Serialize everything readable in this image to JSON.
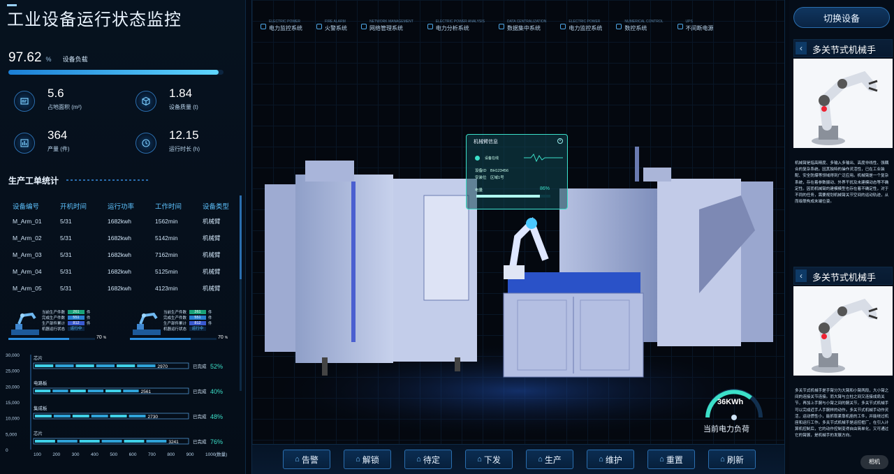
{
  "page": {
    "title": "工业设备运行状态监控"
  },
  "load": {
    "value": "97.62",
    "unit": "%",
    "label": "设备负载",
    "percent": 97.62
  },
  "stats": [
    {
      "value": "5.6",
      "label": "占地面积 (m²)",
      "icon": "area-icon"
    },
    {
      "value": "1.84",
      "label": "设备质量 (t)",
      "icon": "cube-icon"
    },
    {
      "value": "364",
      "label": "产量 (件)",
      "icon": "chart-icon"
    },
    {
      "value": "12.15",
      "label": "运行时长 (h)",
      "icon": "clock-icon"
    }
  ],
  "orders": {
    "title": "生产工单统计",
    "headers": [
      "设备编号",
      "开机时间",
      "运行功率",
      "工作时间",
      "设备类型"
    ],
    "rows": [
      [
        "M_Arm_01",
        "5/31",
        "1682kwh",
        "1562min",
        "机械臂"
      ],
      [
        "M_Arm_02",
        "5/31",
        "1682kwh",
        "5142min",
        "机械臂"
      ],
      [
        "M_Arm_03",
        "5/31",
        "1682kwh",
        "7162min",
        "机械臂"
      ],
      [
        "M_Arm_04",
        "5/31",
        "1682kwh",
        "5125min",
        "机械臂"
      ],
      [
        "M_Arm_05",
        "5/31",
        "1682kwh",
        "4123min",
        "机械臂"
      ]
    ]
  },
  "mini_cards": [
    {
      "rows": [
        [
          "当前生产件数",
          "261",
          "件"
        ],
        [
          "完成生产件数",
          "551",
          "件"
        ],
        [
          "生产部件累计",
          "812",
          "件"
        ],
        [
          "机器运行状态",
          "运行中",
          ""
        ]
      ],
      "pct": "70",
      "pct_unit": "%",
      "fraction": 0.7
    },
    {
      "rows": [
        [
          "当前生产件数",
          "261",
          "件"
        ],
        [
          "完成生产件数",
          "551",
          "件"
        ],
        [
          "生产部件累计",
          "812",
          "件"
        ],
        [
          "机器运行状态",
          "运行中",
          ""
        ]
      ],
      "pct": "70",
      "pct_unit": "%",
      "fraction": 0.7
    }
  ],
  "chart_data": {
    "type": "bar",
    "orientation": "horizontal",
    "y_ticks": [
      "30,000",
      "25,000",
      "20,000",
      "15,000",
      "10,000",
      "5,000",
      "0"
    ],
    "x_ticks": [
      "100",
      "200",
      "300",
      "400",
      "500",
      "600",
      "700",
      "800",
      "900",
      "1000"
    ],
    "x_unit": "(数量)",
    "categories": [
      "芯片",
      "电路板",
      "集成板",
      "芯片"
    ],
    "values": [
      2970,
      2561,
      2730,
      3241
    ],
    "status_label": "已完成",
    "percents": [
      "52%",
      "40%",
      "48%",
      "76%"
    ]
  },
  "systems": [
    {
      "en": "ELECTRIC POWER",
      "cn": "电力监控系统"
    },
    {
      "en": "FIRE ALARM",
      "cn": "火警系统"
    },
    {
      "en": "NETWORK MANAGEMENT",
      "cn": "网络管理系统"
    },
    {
      "en": "ELECTRIC POWER ANALYSIS",
      "cn": "电力分析系统"
    },
    {
      "en": "DATA CENTRALIZATION",
      "cn": "数据集中系统"
    },
    {
      "en": "ELECTRIC POWER",
      "cn": "电力监控系统"
    },
    {
      "en": "NUMERICAL CONTROL",
      "cn": "数控系统"
    },
    {
      "en": "UPS",
      "cn": "不间断电源"
    }
  ],
  "arm_info": {
    "title": "机械臂信息",
    "status": "设备在线",
    "id_label": "设备ID",
    "id_value": "BH123456",
    "pos_label": "安装位",
    "pos_value": "区域1号",
    "power_label": "电量",
    "power_pct": "86%",
    "power_fraction": 0.86,
    "close": "×"
  },
  "gauge": {
    "value": "36KWh",
    "label": "当前电力负荷"
  },
  "controls": [
    "告警",
    "解锁",
    "待定",
    "下发",
    "生产",
    "维护",
    "重置",
    "刷新"
  ],
  "right": {
    "switch_label": "切换设备",
    "cards": [
      {
        "back": "‹",
        "title": "多关节式机械手",
        "text": "机械臂是指高精度、多输入多输出、高度非线性、强耦合的复杂系统。因其独特的操作灵活性，已在工业装配、安全防爆等领域得到广泛应用。机械臂是一个复杂系统，存在着参数摄动、外界干扰及未建模动态等不确定性。因而机械臂的建模模型也存在着不确定性，对于不同的任务，需要规划机械臂关节空间的运动轨迹，从而级联构成末端位姿。"
      },
      {
        "back": "‹",
        "title": "多关节式机械手",
        "text": "多关节式机械手是手臂分为大臂和小臂两段，大小臂之间的连接关节连接。而大臂与立柱之间又连接成肩关节，再加上手腕与小臂之间的腕关节，多关节式机械手可以完成近手人手腕样的动作。多关节式机械手动作灵活，运动惯性小，能抓取紧靠机座的工件，并能绕过机座和运行工作。多关节式机械手是运控框厂，在引入计算机控制后，它的动作控制变得自由简单化，又可通过它的臂展，是机械手的发展方向。"
      }
    ]
  },
  "watermark": "相机"
}
